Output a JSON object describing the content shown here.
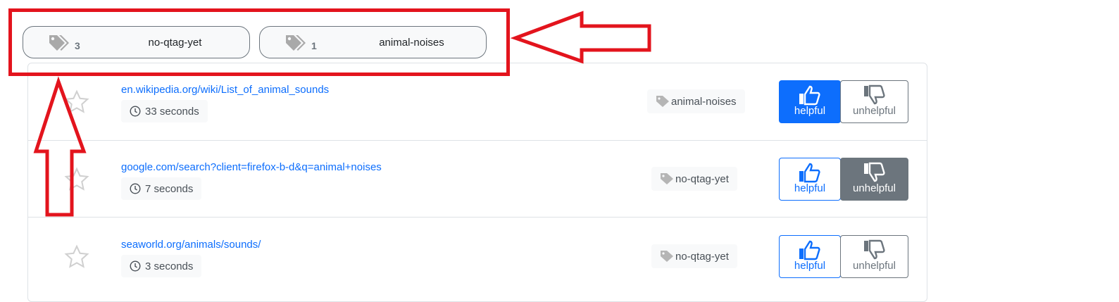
{
  "tag_filters": [
    {
      "icon": "tags-icon",
      "count": "3",
      "name": "no-qtag-yet"
    },
    {
      "icon": "tags-icon",
      "count": "1",
      "name": "animal-noises"
    }
  ],
  "results": [
    {
      "url": "en.wikipedia.org/wiki/List_of_animal_sounds",
      "time": "33 seconds",
      "tag": "animal-noises",
      "helpful_label": "helpful",
      "unhelpful_label": "unhelpful",
      "vote": "helpful"
    },
    {
      "url": "google.com/search?client=firefox-b-d&q=animal+noises",
      "time": "7 seconds",
      "tag": "no-qtag-yet",
      "helpful_label": "helpful",
      "unhelpful_label": "unhelpful",
      "vote": "unhelpful"
    },
    {
      "url": "seaworld.org/animals/sounds/",
      "time": "3 seconds",
      "tag": "no-qtag-yet",
      "helpful_label": "helpful",
      "unhelpful_label": "unhelpful",
      "vote": "none"
    }
  ],
  "colors": {
    "primary": "#0d6efd",
    "secondary": "#6c757d",
    "annotation": "#e3141d"
  }
}
